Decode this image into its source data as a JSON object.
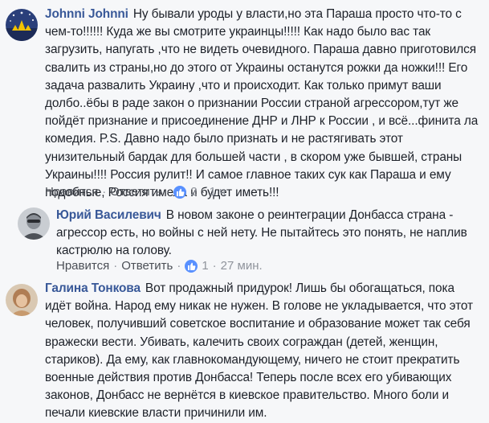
{
  "comments": [
    {
      "author": "Johnni Johnni",
      "text": "Ну бывали уроды у власти,но эта Параша просто что-то с чем-то!!!!!! Куда же вы смотрите украинцы!!!!! Как надо было вас так загрузить, напугать ,что не видеть очевидного. Параша давно приготовился свалить из страны,но до этого от Украины останутся рожки да ножки!!! Его задача развалить Украину ,что и происходит. Как только примут ваши долбо..ёбы в раде закон о признании России страной агрессором,тут же пойдёт признание и присоединение ДНР и ЛНР к России , и всё...финита ла комедия. P.S. Давно надо было признать и не растягивать этот унизительный бардак для большей части , в скором уже бывшей, страны Украины!!!! Россия рулит!! И самое главное таких сук как Параша и ему подобные, Россия имела и будет иметь!!!",
      "like_label": "Нравится",
      "reply_label": "Ответить",
      "reaction_icon": "like-icon",
      "reaction_count": "2",
      "time": "1 ч"
    },
    {
      "author": "Юрий Василевич",
      "text": "В новом законе о реинтеграции Донбасса страна - агрессор есть, но войны с ней нету. Не пытайтесь это понять, не наплив кастрюлю на голову.",
      "like_label": "Нравится",
      "reply_label": "Ответить",
      "reaction_icon": "like-icon",
      "reaction_count": "1",
      "time": "27 мин."
    },
    {
      "author": "Галина Тонкова",
      "text": "Вот продажный придурок! Лишь бы обогащаться, пока идёт война. Народ ему никак не нужен. В голове не укладывается, что этот человек, получивший советское воспитание и образование может так себя вражески вести. Убивать, калечить своих сограждан (детей, женщин, стариков). Да ему, как главнокомандующему, ничего не стоит прекратить военные действия против Донбасса! Теперь после всех его убивающих законов, Донбасс не вернётся в киевское правительство. Много боли и печали киевские власти причинили им."
    }
  ],
  "colors": {
    "author": "#385898",
    "text": "#1d2129",
    "meta": "#90949c",
    "background": "#f6f7f9",
    "like_badge": "#5890ff"
  }
}
